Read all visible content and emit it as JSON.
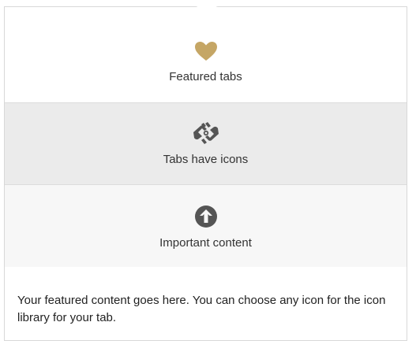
{
  "tabs": [
    {
      "label": "Featured tabs",
      "icon": "heart-icon",
      "icon_color": "#c5a665",
      "active": true
    },
    {
      "label": "Tabs have icons",
      "icon": "sign-language-icon",
      "icon_color": "#555555",
      "active": false
    },
    {
      "label": "Important content",
      "icon": "arrow-circle-up-icon",
      "icon_color": "#555555",
      "active": false
    }
  ],
  "content": {
    "text": "Your featured content goes here. You can choose any icon for the icon library for your tab."
  },
  "colors": {
    "accent": "#c5a665",
    "tab_active_bg": "#ffffff",
    "tab_bg": "#ebebeb",
    "tab_bg_light": "#f7f7f7",
    "border": "#dcdcdc"
  }
}
